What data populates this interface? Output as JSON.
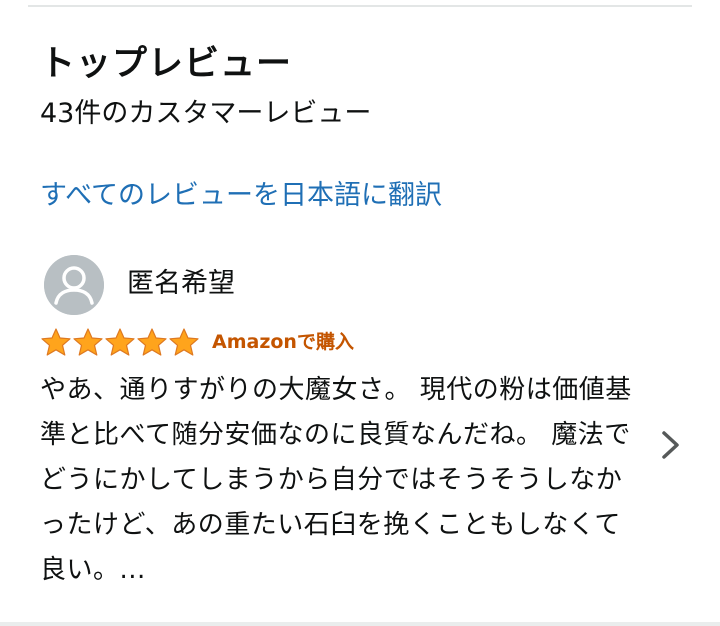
{
  "section": {
    "title": "トップレビュー",
    "review_count": "43件のカスタマーレビュー",
    "translate_link": "すべてのレビューを日本語に翻訳"
  },
  "review": {
    "reviewer_name": "匿名希望",
    "rating": 5,
    "rating_max": 5,
    "verified_label": "Amazonで購入",
    "text": "やあ、通りすがりの大魔女さ。 現代の粉は価値基準と比べて随分安価なのに良質なんだね。 魔法でどうにかしてしまうから自分ではそうそうしなかったけど、あの重たい石臼を挽くこともしなくて良い。..."
  },
  "icons": {
    "avatar": "default-user-avatar-icon",
    "star": "star-filled-icon",
    "next": "chevron-right-icon"
  },
  "colors": {
    "link": "#1f6fb5",
    "star": "#ffa41c",
    "verified": "#c45500",
    "avatar_bg": "#b8bfc3"
  }
}
